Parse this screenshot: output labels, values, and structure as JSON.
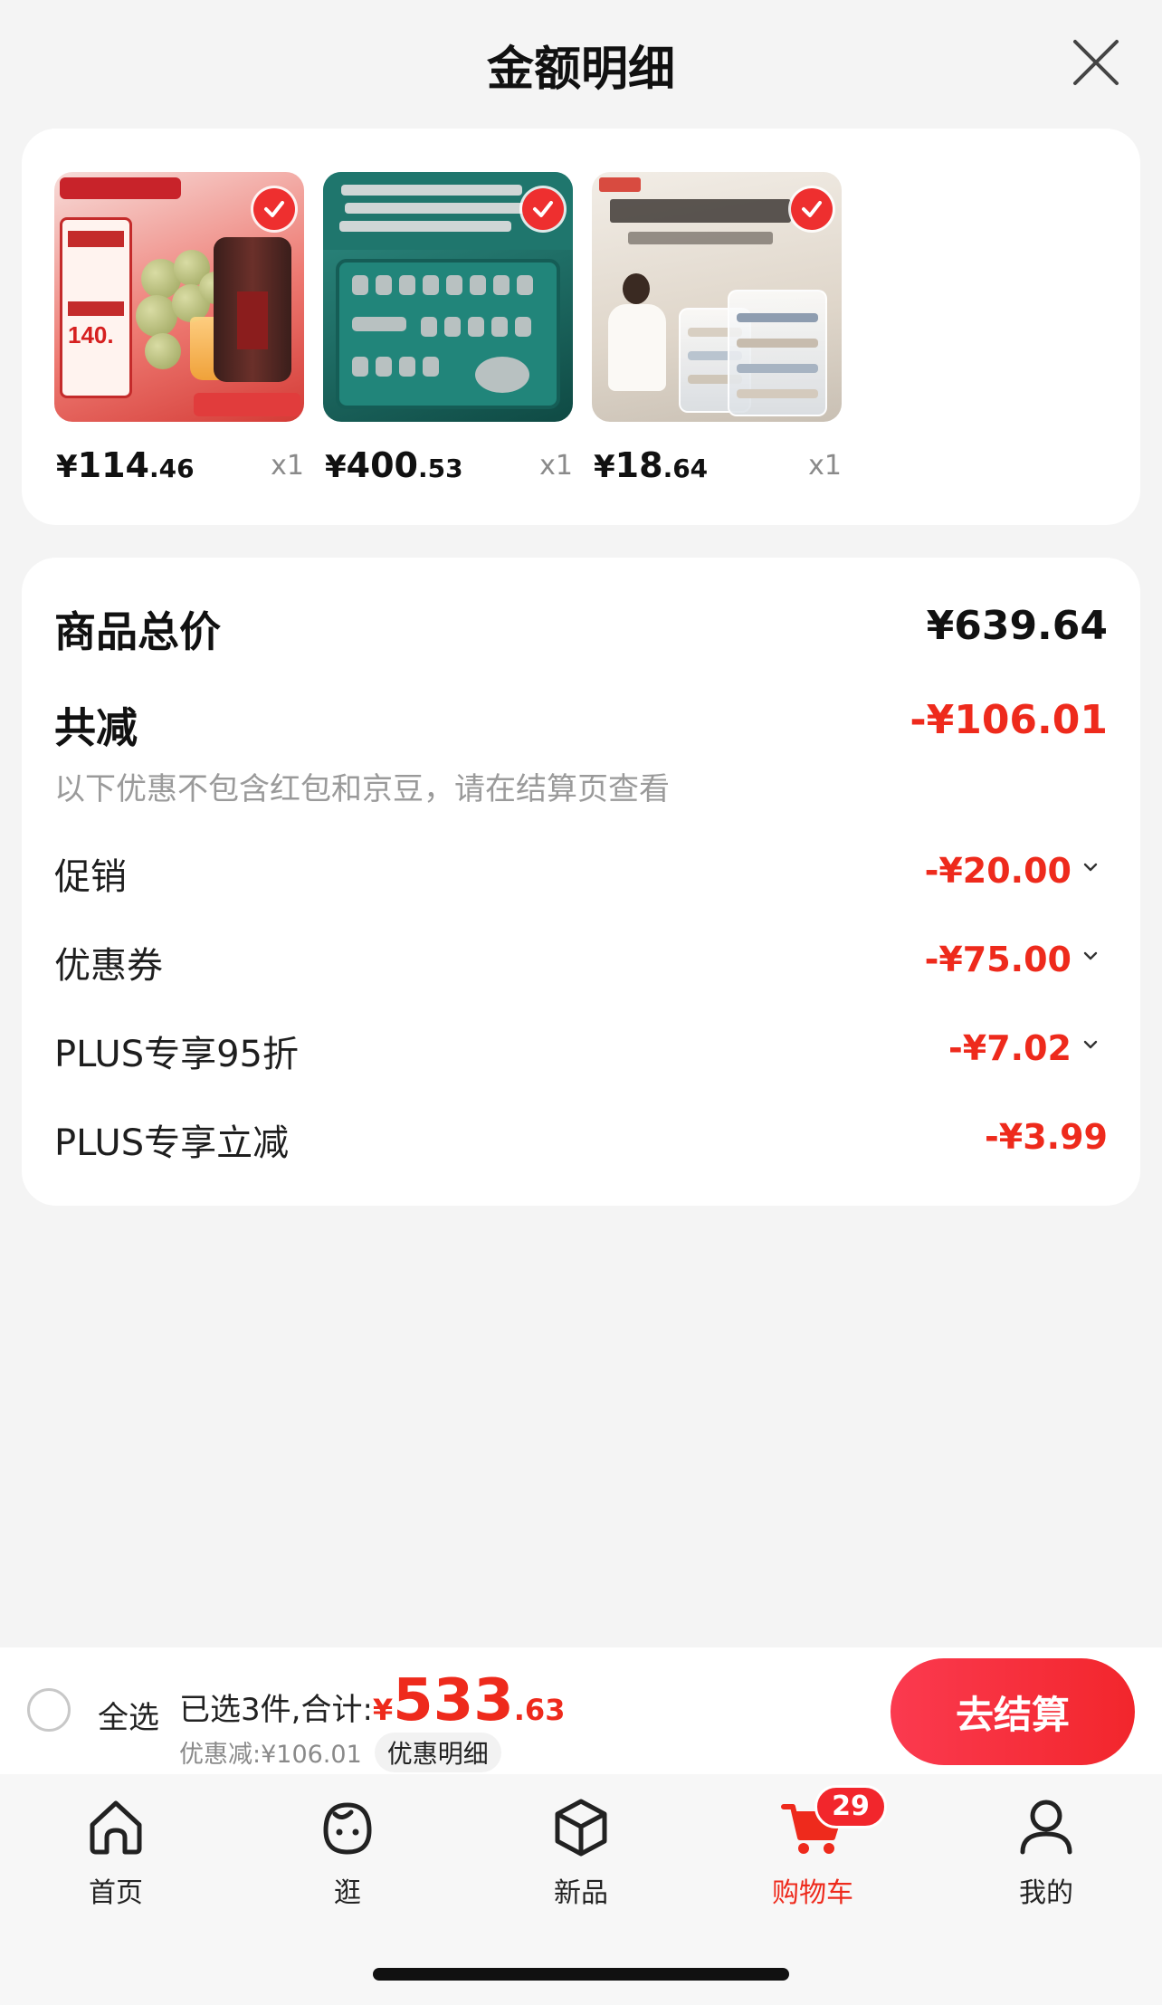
{
  "header": {
    "title": "金额明细"
  },
  "products": [
    {
      "price_currency": "¥",
      "price_int": "114",
      "price_dec": ".46",
      "qty": "x1"
    },
    {
      "price_currency": "¥",
      "price_int": "400",
      "price_dec": ".53",
      "qty": "x1"
    },
    {
      "price_currency": "¥",
      "price_int": "18",
      "price_dec": ".64",
      "qty": "x1"
    }
  ],
  "summary": {
    "total_label": "商品总价",
    "total_value": "¥639.64",
    "discount_label": "共减",
    "discount_value": "-¥106.01",
    "note": "以下优惠不包含红包和京豆，请在结算页查看",
    "items": [
      {
        "label": "促销",
        "value": "-¥20.00"
      },
      {
        "label": "优惠券",
        "value": "-¥75.00"
      },
      {
        "label": "PLUS专享95折",
        "value": "-¥7.02"
      },
      {
        "label": "PLUS专享立减",
        "value": "-¥3.99"
      }
    ]
  },
  "checkout": {
    "select_all": "全选",
    "selected_text": "已选3件,合计:",
    "total_currency": "¥",
    "total_int": "533",
    "total_dec": ".63",
    "discount_text": "优惠减:¥106.01",
    "detail_link": "优惠明细",
    "button": "去结算"
  },
  "tabbar": {
    "tabs": [
      {
        "label": "首页",
        "icon": "home-icon"
      },
      {
        "label": "逛",
        "icon": "browse-face-icon"
      },
      {
        "label": "新品",
        "icon": "cube-icon"
      },
      {
        "label": "购物车",
        "icon": "cart-icon",
        "badge": "29",
        "active": true
      },
      {
        "label": "我的",
        "icon": "person-icon"
      }
    ]
  },
  "colors": {
    "accent": "#ee2a1c",
    "button": "#f2262c",
    "background": "#f4f4f4"
  }
}
